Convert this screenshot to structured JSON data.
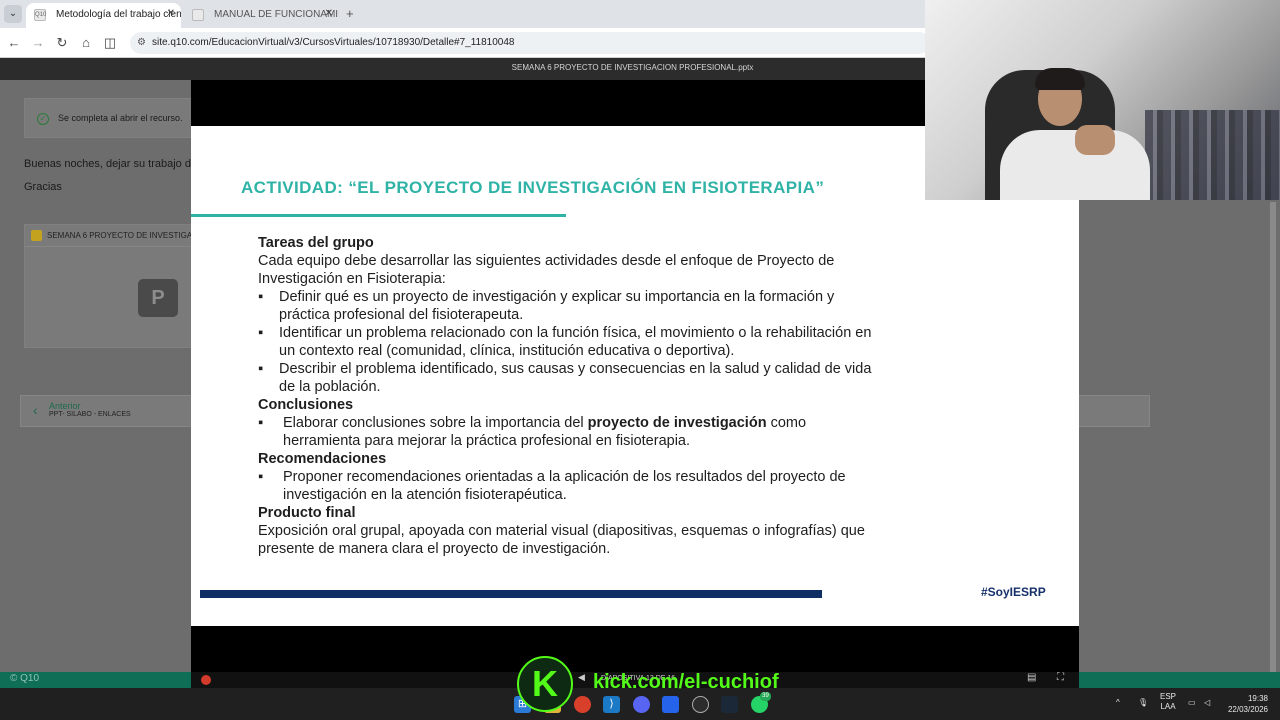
{
  "browser": {
    "tabs": [
      {
        "title": "Metodología del trabajo científico",
        "favicon": "Q10",
        "active": true
      },
      {
        "title": "MANUAL DE FUNCIONAMIENTO",
        "active": false
      }
    ],
    "url": "site.q10.com/EducacionVirtual/v3/CursosVirtuales/10718930/Detalle#7_11810048"
  },
  "page": {
    "completion_note": "Se completa al abrir el recurso.",
    "message_line1": "Buenas noches, dejar su trabajo de",
    "message_line2": "Gracias",
    "resource_title": "SEMANA 6 PROYECTO DE INVESTIGAC",
    "resource_letter": "P",
    "prev_label": "Anterior",
    "prev_item": "PPT- SILABO - ENLACES",
    "footer": "© Q10"
  },
  "viewer": {
    "file_title": "SEMANA 6 PROYECTO DE INVESTIGACION PROFESIONAL.pptx",
    "control_text": "DIAPOSITIVA 13 DE 16"
  },
  "slide": {
    "title": "ACTIVIDAD: “EL PROYECTO DE INVESTIGACIÓN EN FISIOTERAPIA”",
    "tasks_heading": "Tareas del grupo",
    "tasks_intro": "Cada equipo debe desarrollar las siguientes actividades desde el enfoque de Proyecto de Investigación en Fisioterapia:",
    "tasks": [
      "Definir qué es un proyecto de investigación y explicar su importancia en la formación y práctica profesional del fisioterapeuta.",
      "Identificar un problema relacionado con la función física, el movimiento o la rehabilitación en un contexto real (comunidad, clínica, institución educativa o deportiva).",
      "Describir el problema identificado, sus causas y consecuencias en la salud y calidad de vida de la población."
    ],
    "conclusions_heading": "Conclusiones",
    "conclusions_pre": "Elaborar conclusiones sobre la importancia del ",
    "conclusions_bold": "proyecto de investigación",
    "conclusions_post": " como herramienta para mejorar la práctica profesional en fisioterapia.",
    "recommendations_heading": "Recomendaciones",
    "recommendations": "Proponer recomendaciones orientadas a la aplicación de los resultados del proyecto de investigación en la atención fisioterapéutica.",
    "product_heading": "Producto final",
    "product_text": "Exposición oral grupal, apoyada con material visual (diapositivas, esquemas o infografías) que presente de manera clara el proyecto de investigación.",
    "hashtag": "#SoyIESRP"
  },
  "overlay": {
    "kick_letter": "K",
    "kick_url": "kick.com/el-cuchiof"
  },
  "taskbar": {
    "language": "ESP",
    "layout": "LAA",
    "time": "19:38",
    "date": "22/03/2026",
    "whatsapp_badge": "39"
  },
  "colors": {
    "accent_teal": "#2fb3a6",
    "navy": "#0f2e63",
    "kick_green": "#53fc18",
    "footer_green": "#0f6e56"
  }
}
